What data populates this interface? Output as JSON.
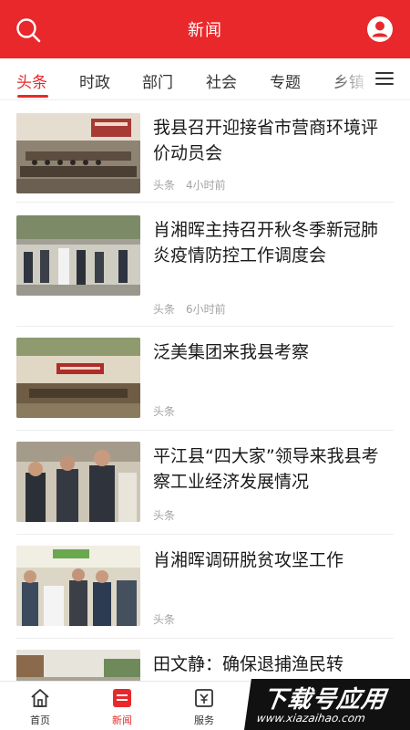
{
  "header": {
    "title": "新闻",
    "search_icon": "search-icon",
    "user_icon": "user-icon",
    "background_color": "#e8282b"
  },
  "tabs": {
    "active": 0,
    "items": [
      {
        "label": "头条"
      },
      {
        "label": "时政"
      },
      {
        "label": "部门"
      },
      {
        "label": "社会"
      },
      {
        "label": "专题"
      },
      {
        "label": "乡镇"
      }
    ],
    "menu_icon": "menu-icon"
  },
  "news": [
    {
      "title": "我县召开迎接省市营商环境评价动员会",
      "source": "头条",
      "time": "4小时前"
    },
    {
      "title": "肖湘晖主持召开秋冬季新冠肺炎疫情防控工作调度会",
      "source": "头条",
      "time": "6小时前"
    },
    {
      "title": "泛美集团来我县考察",
      "source": "头条",
      "time": ""
    },
    {
      "title": "平江县“四大家”领导来我县考察工业经济发展情况",
      "source": "头条",
      "time": ""
    },
    {
      "title": "肖湘晖调研脱贫攻坚工作",
      "source": "头条",
      "time": ""
    },
    {
      "title": "田文静：确保退捕渔民转",
      "source": "",
      "time": ""
    }
  ],
  "bottom_nav": {
    "active": 1,
    "items": [
      {
        "label": "首页",
        "icon": "home-icon"
      },
      {
        "label": "新闻",
        "icon": "news-icon"
      },
      {
        "label": "服务",
        "icon": "service-icon"
      }
    ]
  },
  "watermark": {
    "main": "下载号应用",
    "sub": "www.xiazaihao.com"
  },
  "colors": {
    "accent": "#e8282b",
    "meta_text": "#a3a3a3",
    "divider": "#ececec"
  }
}
